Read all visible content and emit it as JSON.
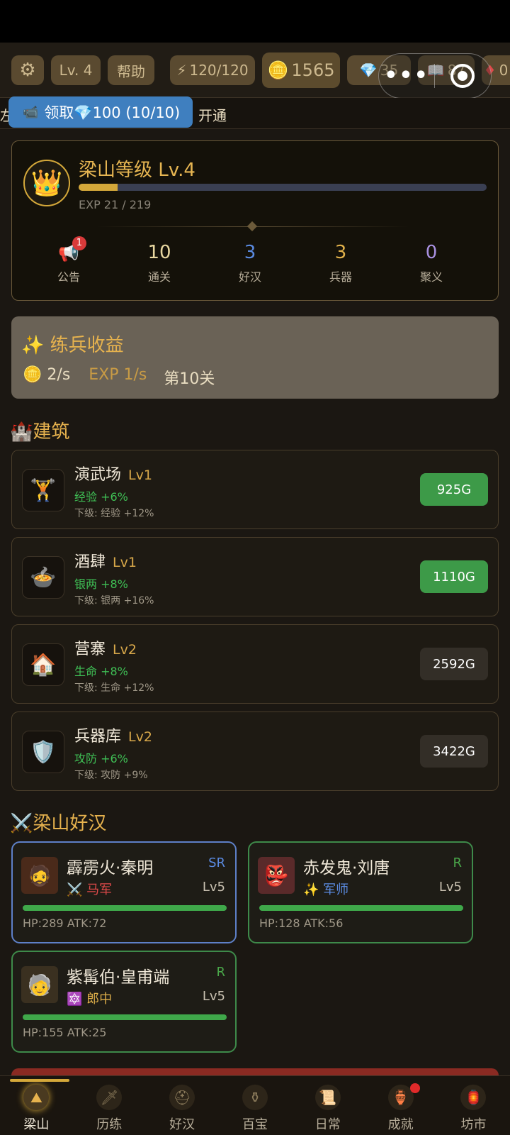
{
  "topbar": {
    "level": "Lv. 4",
    "help": "帮助",
    "energy": "120/120",
    "coins": "1565",
    "gems": "35",
    "scrolls": "87",
    "more": "0"
  },
  "ticker": {
    "left_fragment": "左",
    "claim_label": "领取💎100 (10/10)",
    "tail": "开通"
  },
  "level_card": {
    "title": "梁山等级 Lv.4",
    "exp_text": "EXP 21 / 219",
    "exp_progress": 0.096,
    "stats": [
      {
        "value": "",
        "label": "公告",
        "badge": "1"
      },
      {
        "value": "10",
        "label": "通关",
        "color": "#e8d7a0"
      },
      {
        "value": "3",
        "label": "好汉",
        "color": "#5a8ae0"
      },
      {
        "value": "3",
        "label": "兵器",
        "color": "#e0b04a"
      },
      {
        "value": "0",
        "label": "聚义",
        "color": "#a890e0"
      }
    ]
  },
  "training": {
    "title": "✨ 练兵收益",
    "gold_rate": "2/s",
    "exp_rate": "EXP 1/s",
    "stage": "第10关"
  },
  "sections": {
    "buildings": "建筑",
    "heroes": "梁山好汉"
  },
  "buildings": [
    {
      "name": "演武场",
      "level": "Lv1",
      "bonus": "经验 +6%",
      "next": "下级: 经验 +12%",
      "cost": "925G",
      "affordable": true,
      "icon": "weightlifter-icon"
    },
    {
      "name": "酒肆",
      "level": "Lv1",
      "bonus": "银两 +8%",
      "next": "下级: 银两 +16%",
      "cost": "1110G",
      "affordable": true,
      "icon": "bowl-icon"
    },
    {
      "name": "营寨",
      "level": "Lv2",
      "bonus": "生命 +8%",
      "next": "下级: 生命 +12%",
      "cost": "2592G",
      "affordable": false,
      "icon": "house-icon"
    },
    {
      "name": "兵器库",
      "level": "Lv2",
      "bonus": "攻防 +6%",
      "next": "下级: 攻防 +9%",
      "cost": "3422G",
      "affordable": false,
      "icon": "shield-icon"
    }
  ],
  "heroes": [
    {
      "name": "霹雳火·秦明",
      "rarity": "SR",
      "class_icon": "⚔️",
      "class": "马军",
      "class_color": "#e04a4a",
      "level": "Lv5",
      "stats": "HP:289 ATK:72",
      "hp": 1.0
    },
    {
      "name": "赤发鬼·刘唐",
      "rarity": "R",
      "class_icon": "✨",
      "class": "军师",
      "class_color": "#5a8ae0",
      "level": "Lv5",
      "stats": "HP:128 ATK:56",
      "hp": 1.0
    },
    {
      "name": "紫髯伯·皇甫端",
      "rarity": "R",
      "class_icon": "🔯",
      "class": "郎中",
      "class_color": "#e0b04a",
      "level": "Lv5",
      "stats": "HP:155 ATK:25",
      "hp": 1.0
    }
  ],
  "nav": [
    {
      "label": "梁山",
      "icon": "mountain-emblem-icon",
      "active": true
    },
    {
      "label": "历练",
      "icon": "sword-icon",
      "active": false
    },
    {
      "label": "好汉",
      "icon": "helmet-icon",
      "active": false
    },
    {
      "label": "百宝",
      "icon": "treasure-icon",
      "active": false
    },
    {
      "label": "日常",
      "icon": "scroll-icon",
      "active": false
    },
    {
      "label": "成就",
      "icon": "gourd-icon",
      "active": false,
      "dot": true
    },
    {
      "label": "坊市",
      "icon": "shop-icon",
      "active": false
    }
  ],
  "colors": {
    "accent_gold": "#e6b24e",
    "bonus_green": "#3fbf55",
    "buy_green": "#3d9a48",
    "claim_blue": "#3f7fbf"
  }
}
